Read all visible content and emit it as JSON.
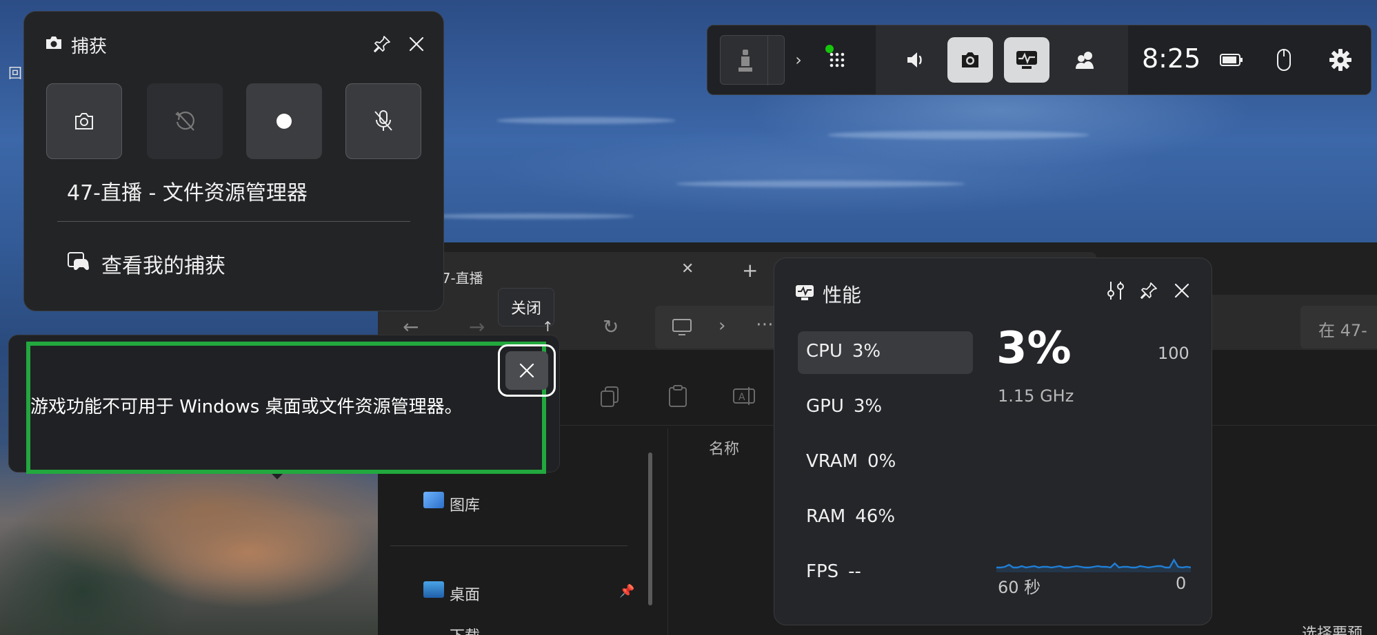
{
  "wallpaper": {
    "name": "desktop-wallpaper"
  },
  "desktop": {
    "edge_label": "回"
  },
  "explorer": {
    "tab_title": "47-直播",
    "tab_close_glyph": "✕",
    "new_tab_glyph": "+",
    "search_placeholder": "在 47-",
    "column_name": "名称",
    "nav_items": [
      {
        "label": "图库",
        "icon": "gallery-icon"
      },
      {
        "label": "桌面",
        "icon": "desktop-folder-icon"
      },
      {
        "label": "下载",
        "icon": "downloads-folder-icon"
      }
    ],
    "preview_hint": "选择要预览"
  },
  "gamebar": {
    "time": "8:25",
    "widgets": [
      "game-thumbnail-icon",
      "widget-menu-icon",
      "audio-icon",
      "capture-icon",
      "performance-icon",
      "xbox-social-icon",
      "battery-icon",
      "mouse-icon",
      "settings-icon"
    ],
    "active_color": "#d9dadc",
    "status_dot_color": "#16c60c"
  },
  "capture": {
    "title": "捕获",
    "source": "47-直播 - 文件资源管理器",
    "view_label": "查看我的捕获",
    "buttons": [
      "screenshot-icon",
      "record-last-30s-icon",
      "start-recording-icon",
      "mic-off-icon"
    ]
  },
  "tooltip": {
    "text": "关闭"
  },
  "toast": {
    "message": "游戏功能不可用于 Windows 桌面或文件资源管理器。",
    "highlight_color": "#22a83e"
  },
  "performance": {
    "title": "性能",
    "metrics": [
      {
        "name": "CPU",
        "value": "3%",
        "selected": true
      },
      {
        "name": "GPU",
        "value": "3%"
      },
      {
        "name": "VRAM",
        "value": "0%"
      },
      {
        "name": "RAM",
        "value": "46%"
      },
      {
        "name": "FPS",
        "value": "--"
      }
    ],
    "big_value": "3%",
    "max_label": "100",
    "frequency": "1.15 GHz",
    "axis_left": "60 秒",
    "axis_right": "0",
    "graph_color": "#1f7fd6"
  },
  "chart_data": {
    "type": "line",
    "title": "",
    "xlabel": "",
    "ylabel": "",
    "ylim": [
      0,
      100
    ],
    "x_range_label": [
      "60 秒",
      "0"
    ],
    "series": [
      {
        "values": [
          3,
          3,
          4,
          7,
          3,
          3,
          5,
          3,
          4,
          5,
          3,
          4,
          4,
          3,
          4,
          5,
          3,
          3,
          4,
          5,
          4,
          3,
          3,
          4,
          5,
          4,
          4,
          3,
          9,
          3,
          4,
          4,
          3,
          3,
          5,
          4,
          3,
          4,
          5,
          5,
          3,
          3,
          14,
          4,
          3,
          4,
          3
        ]
      }
    ]
  }
}
